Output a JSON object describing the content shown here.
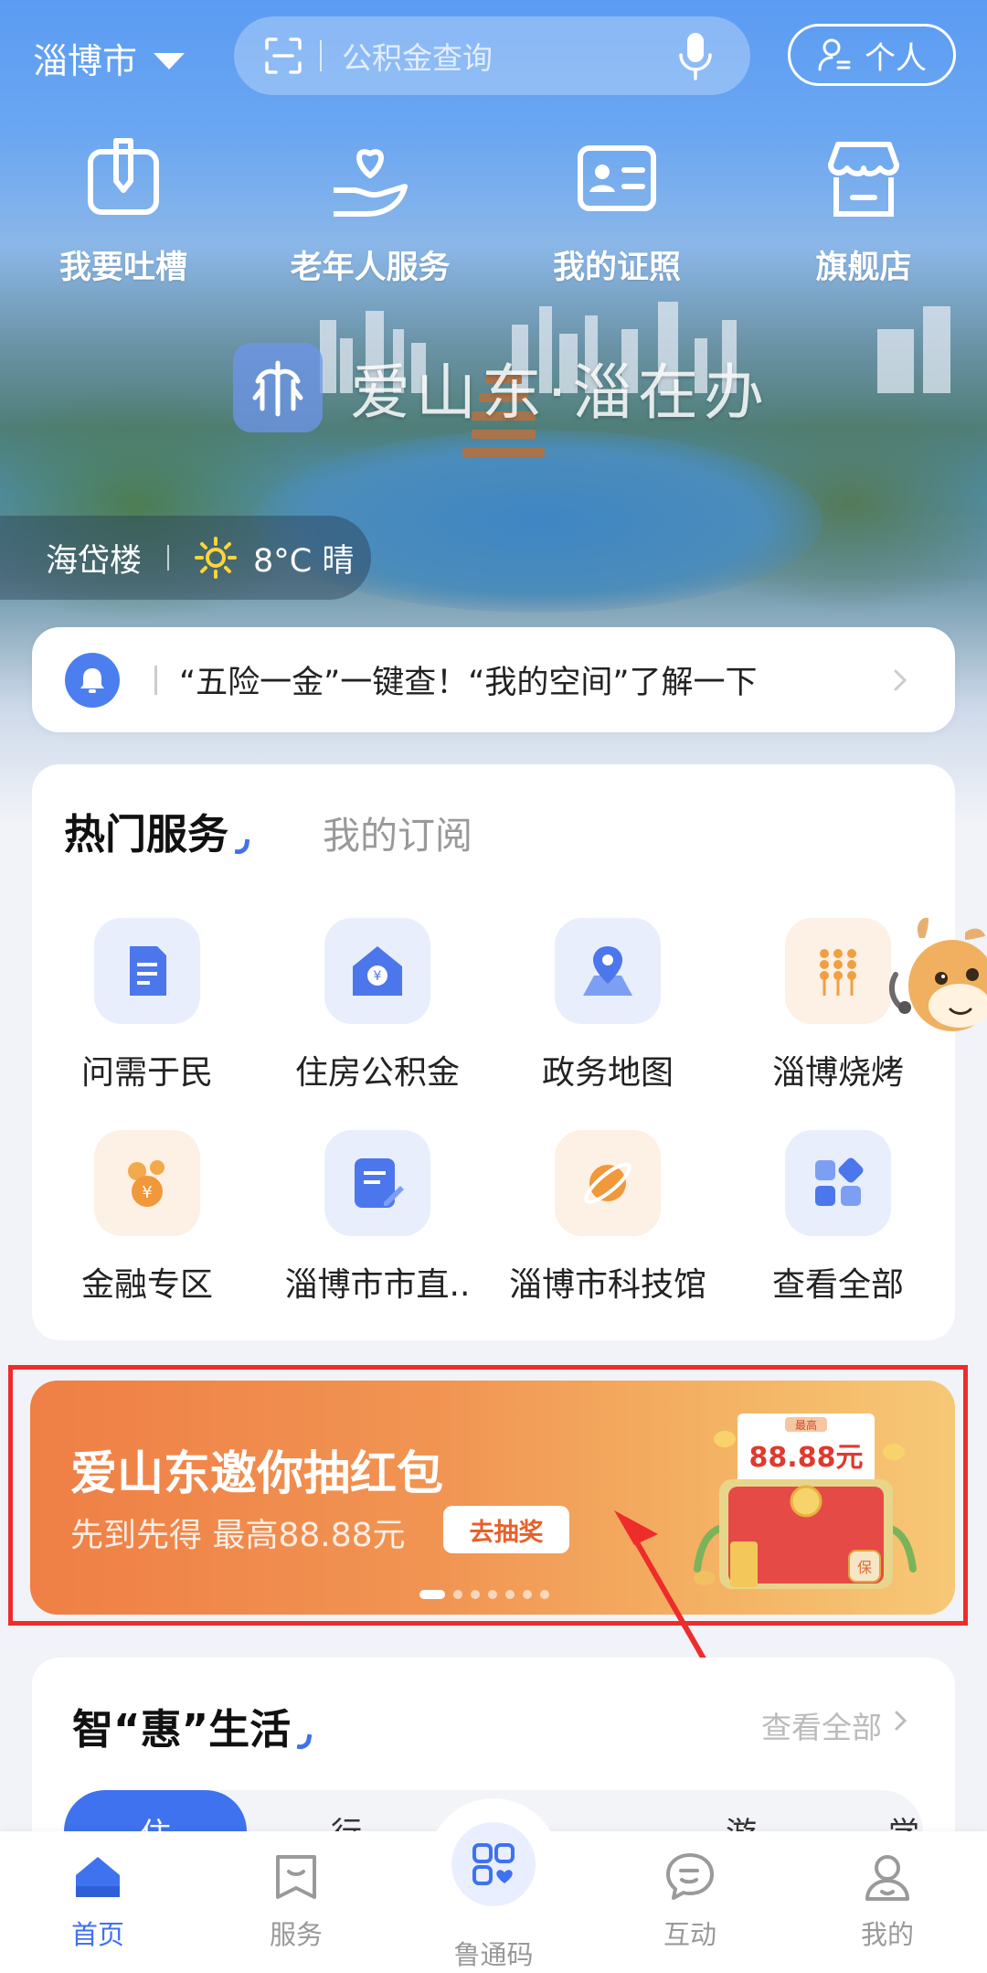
{
  "header": {
    "city": "淄博市",
    "search_placeholder": "公积金查询",
    "personal_label": "个人"
  },
  "quick_actions": [
    {
      "label": "我要吐槽",
      "icon": "feedback-icon"
    },
    {
      "label": "老年人服务",
      "icon": "elderly-care-icon"
    },
    {
      "label": "我的证照",
      "icon": "id-card-icon"
    },
    {
      "label": "旗舰店",
      "icon": "store-icon"
    }
  ],
  "hero": {
    "slogan": "爱山东·淄在办",
    "location": "海岱楼",
    "weather": "8°C 晴"
  },
  "notice": {
    "text": "“五险一金”一键查！“我的空间”了解一下"
  },
  "hot_services": {
    "tab_active": "热门服务",
    "tab_other": "我的订阅",
    "items": [
      {
        "label": "问需于民",
        "icon": "document-icon"
      },
      {
        "label": "住房公积金",
        "icon": "housing-fund-icon"
      },
      {
        "label": "政务地图",
        "icon": "map-pin-icon"
      },
      {
        "label": "淄博烧烤",
        "icon": "skewers-icon"
      },
      {
        "label": "金融专区",
        "icon": "coins-icon"
      },
      {
        "label": "淄博市市直..",
        "icon": "edit-form-icon"
      },
      {
        "label": "淄博市科技馆",
        "icon": "planet-icon"
      },
      {
        "label": "查看全部",
        "icon": "grid-icon"
      }
    ]
  },
  "banner": {
    "title": "爱山东邀你抽红包",
    "subtitle": "先到先得 最高88.88元",
    "button": "去抽奖",
    "pack_top": "最高",
    "pack_amount": "88.88元",
    "pack_badge": "保",
    "slide_count": 7,
    "active_slide": 1
  },
  "smart_life": {
    "title": "智“惠”生活",
    "view_all": "查看全部",
    "categories": [
      "住",
      "行",
      "游",
      "学"
    ]
  },
  "tabbar": [
    {
      "label": "首页",
      "active": true
    },
    {
      "label": "服务",
      "active": false
    },
    {
      "label": "鲁通码",
      "active": false
    },
    {
      "label": "互动",
      "active": false
    },
    {
      "label": "我的",
      "active": false
    }
  ],
  "colors": {
    "primary": "#3f72ee",
    "highlight_border": "#ee2c2c",
    "banner_orange": "#ef7f45"
  }
}
